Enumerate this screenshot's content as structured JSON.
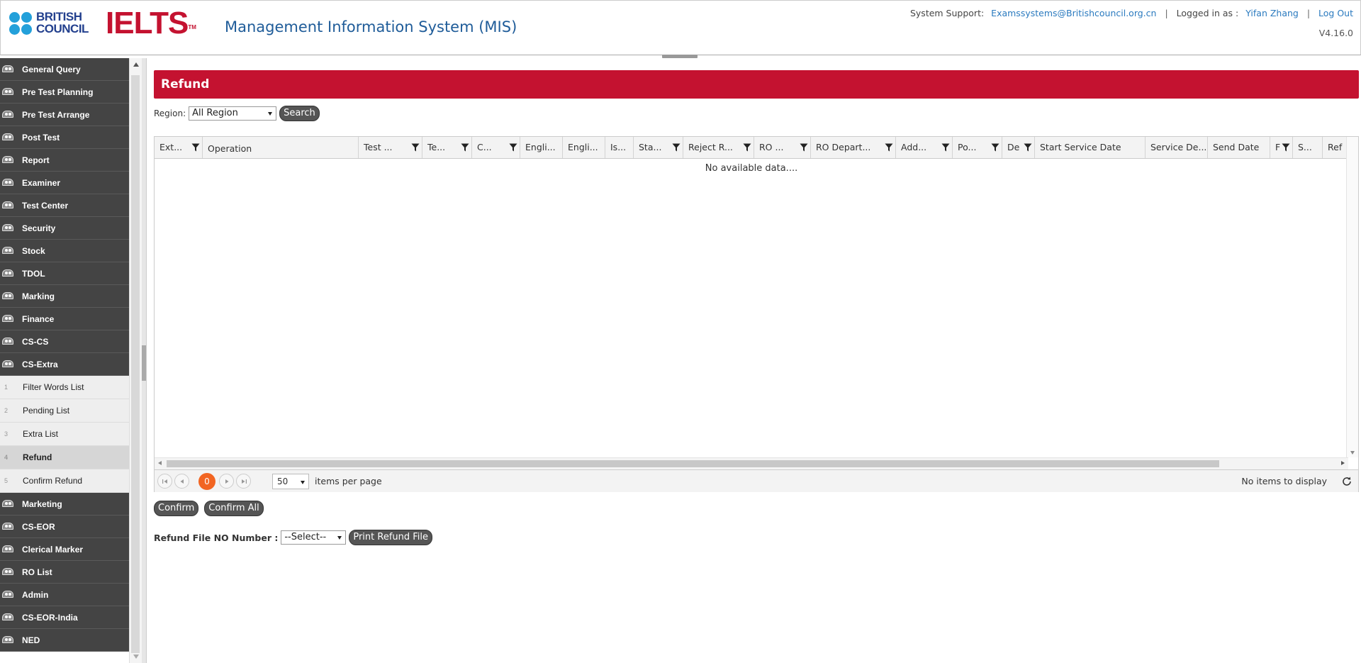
{
  "header": {
    "brand_line1": "BRITISH",
    "brand_line2": "COUNCIL",
    "ielts": "IELTS",
    "ielts_tm": "TM",
    "system_title": "Management Information System (MIS)",
    "support_label": "System Support:",
    "support_email": "Examssystems@Britishcouncil.org.cn",
    "logged_in_label": "Logged in as :",
    "user_name": "Yifan Zhang",
    "logout": "Log Out",
    "version": "V4.16.0",
    "separator": "|"
  },
  "sidebar": {
    "items_top": [
      {
        "label": "General Query"
      },
      {
        "label": "Pre Test Planning"
      },
      {
        "label": "Pre Test Arrange"
      },
      {
        "label": "Post Test"
      },
      {
        "label": "Report"
      },
      {
        "label": "Examiner"
      },
      {
        "label": "Test Center"
      },
      {
        "label": "Security"
      },
      {
        "label": "Stock"
      },
      {
        "label": "TDOL"
      },
      {
        "label": "Marking"
      },
      {
        "label": "Finance"
      },
      {
        "label": "CS-CS"
      },
      {
        "label": "CS-Extra"
      }
    ],
    "sub_items": [
      {
        "num": "1",
        "label": "Filter Words List"
      },
      {
        "num": "2",
        "label": "Pending List"
      },
      {
        "num": "3",
        "label": "Extra List"
      },
      {
        "num": "4",
        "label": "Refund"
      },
      {
        "num": "5",
        "label": "Confirm Refund"
      }
    ],
    "items_bottom": [
      {
        "label": "Marketing"
      },
      {
        "label": "CS-EOR"
      },
      {
        "label": "Clerical Marker"
      },
      {
        "label": "RO List"
      },
      {
        "label": "Admin"
      },
      {
        "label": "CS-EOR-India"
      },
      {
        "label": "NED"
      }
    ]
  },
  "main": {
    "title": "Refund",
    "region_label": "Region:",
    "region_value": "All Region",
    "search_button": "Search",
    "columns": [
      {
        "label": "Ext..."
      },
      {
        "label": "Operation"
      },
      {
        "label": "Test ..."
      },
      {
        "label": "Te..."
      },
      {
        "label": "C..."
      },
      {
        "label": "Engli..."
      },
      {
        "label": "Engli..."
      },
      {
        "label": "Is..."
      },
      {
        "label": "Sta..."
      },
      {
        "label": "Reject R..."
      },
      {
        "label": "RO ..."
      },
      {
        "label": "RO Depart..."
      },
      {
        "label": "Add..."
      },
      {
        "label": "Po..."
      },
      {
        "label": "De"
      },
      {
        "label": "Start Service Date"
      },
      {
        "label": "Service De..."
      },
      {
        "label": "Send Date"
      },
      {
        "label": "F"
      },
      {
        "label": "S..."
      },
      {
        "label": "Ref"
      }
    ],
    "no_data": "No available data....",
    "pager": {
      "current_page": "0",
      "page_size": "50",
      "items_per_page": "items per page",
      "info": "No items to display"
    },
    "confirm_button": "Confirm",
    "confirm_all_button": "Confirm All",
    "refund_file_label": "Refund File NO Number :",
    "refund_file_select": "--Select--",
    "print_button": "Print Refund File"
  },
  "colors": {
    "brand_red": "#c41230",
    "brand_blue": "#23a0da",
    "nav_bg": "#444444",
    "pager_current": "#f26522",
    "link": "#2a7abf"
  }
}
